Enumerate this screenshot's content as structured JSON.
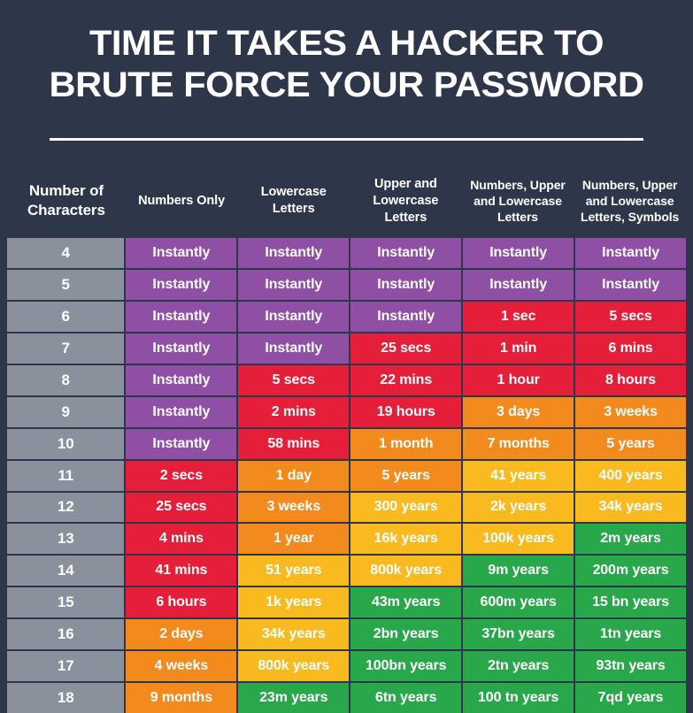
{
  "title": {
    "line1": "TIME IT TAKES A HACKER TO",
    "line2": "BRUTE FORCE YOUR PASSWORD"
  },
  "colors": {
    "background": "#2e3649",
    "label_column": "#8a909c",
    "purple": "#8e4fa5",
    "red": "#e51f39",
    "orange": "#f28a1e",
    "yellow": "#f8ba1f",
    "green": "#28a84a",
    "text": "#ffffff"
  },
  "table": {
    "headers": [
      "Number of Characters",
      "Numbers Only",
      "Lowercase Letters",
      "Upper and Lowercase Letters",
      "Numbers, Upper and Lowercase Letters",
      "Numbers, Upper and Lowercase Letters, Symbols"
    ],
    "rows": [
      {
        "chars": "4",
        "cells": [
          {
            "text": "Instantly",
            "sev": "purple"
          },
          {
            "text": "Instantly",
            "sev": "purple"
          },
          {
            "text": "Instantly",
            "sev": "purple"
          },
          {
            "text": "Instantly",
            "sev": "purple"
          },
          {
            "text": "Instantly",
            "sev": "purple"
          }
        ]
      },
      {
        "chars": "5",
        "cells": [
          {
            "text": "Instantly",
            "sev": "purple"
          },
          {
            "text": "Instantly",
            "sev": "purple"
          },
          {
            "text": "Instantly",
            "sev": "purple"
          },
          {
            "text": "Instantly",
            "sev": "purple"
          },
          {
            "text": "Instantly",
            "sev": "purple"
          }
        ]
      },
      {
        "chars": "6",
        "cells": [
          {
            "text": "Instantly",
            "sev": "purple"
          },
          {
            "text": "Instantly",
            "sev": "purple"
          },
          {
            "text": "Instantly",
            "sev": "purple"
          },
          {
            "text": "1 sec",
            "sev": "red"
          },
          {
            "text": "5 secs",
            "sev": "red"
          }
        ]
      },
      {
        "chars": "7",
        "cells": [
          {
            "text": "Instantly",
            "sev": "purple"
          },
          {
            "text": "Instantly",
            "sev": "purple"
          },
          {
            "text": "25 secs",
            "sev": "red"
          },
          {
            "text": "1 min",
            "sev": "red"
          },
          {
            "text": "6 mins",
            "sev": "red"
          }
        ]
      },
      {
        "chars": "8",
        "cells": [
          {
            "text": "Instantly",
            "sev": "purple"
          },
          {
            "text": "5 secs",
            "sev": "red"
          },
          {
            "text": "22 mins",
            "sev": "red"
          },
          {
            "text": "1 hour",
            "sev": "red"
          },
          {
            "text": "8 hours",
            "sev": "red"
          }
        ]
      },
      {
        "chars": "9",
        "cells": [
          {
            "text": "Instantly",
            "sev": "purple"
          },
          {
            "text": "2 mins",
            "sev": "red"
          },
          {
            "text": "19 hours",
            "sev": "red"
          },
          {
            "text": "3 days",
            "sev": "orange"
          },
          {
            "text": "3 weeks",
            "sev": "orange"
          }
        ]
      },
      {
        "chars": "10",
        "cells": [
          {
            "text": "Instantly",
            "sev": "purple"
          },
          {
            "text": "58 mins",
            "sev": "red"
          },
          {
            "text": "1 month",
            "sev": "orange"
          },
          {
            "text": "7 months",
            "sev": "orange"
          },
          {
            "text": "5 years",
            "sev": "orange"
          }
        ]
      },
      {
        "chars": "11",
        "cells": [
          {
            "text": "2 secs",
            "sev": "red"
          },
          {
            "text": "1 day",
            "sev": "orange"
          },
          {
            "text": "5 years",
            "sev": "orange"
          },
          {
            "text": "41 years",
            "sev": "yellow"
          },
          {
            "text": "400 years",
            "sev": "yellow"
          }
        ]
      },
      {
        "chars": "12",
        "cells": [
          {
            "text": "25 secs",
            "sev": "red"
          },
          {
            "text": "3 weeks",
            "sev": "orange"
          },
          {
            "text": "300 years",
            "sev": "yellow"
          },
          {
            "text": "2k years",
            "sev": "yellow"
          },
          {
            "text": "34k years",
            "sev": "yellow"
          }
        ]
      },
      {
        "chars": "13",
        "cells": [
          {
            "text": "4 mins",
            "sev": "red"
          },
          {
            "text": "1 year",
            "sev": "orange"
          },
          {
            "text": "16k years",
            "sev": "yellow"
          },
          {
            "text": "100k years",
            "sev": "yellow"
          },
          {
            "text": "2m years",
            "sev": "green"
          }
        ]
      },
      {
        "chars": "14",
        "cells": [
          {
            "text": "41 mins",
            "sev": "red"
          },
          {
            "text": "51 years",
            "sev": "yellow"
          },
          {
            "text": "800k years",
            "sev": "yellow"
          },
          {
            "text": "9m years",
            "sev": "green"
          },
          {
            "text": "200m years",
            "sev": "green"
          }
        ]
      },
      {
        "chars": "15",
        "cells": [
          {
            "text": "6 hours",
            "sev": "red"
          },
          {
            "text": "1k years",
            "sev": "yellow"
          },
          {
            "text": "43m years",
            "sev": "green"
          },
          {
            "text": "600m years",
            "sev": "green"
          },
          {
            "text": "15 bn years",
            "sev": "green"
          }
        ]
      },
      {
        "chars": "16",
        "cells": [
          {
            "text": "2 days",
            "sev": "orange"
          },
          {
            "text": "34k years",
            "sev": "yellow"
          },
          {
            "text": "2bn years",
            "sev": "green"
          },
          {
            "text": "37bn years",
            "sev": "green"
          },
          {
            "text": "1tn years",
            "sev": "green"
          }
        ]
      },
      {
        "chars": "17",
        "cells": [
          {
            "text": "4 weeks",
            "sev": "orange"
          },
          {
            "text": "800k years",
            "sev": "yellow"
          },
          {
            "text": "100bn years",
            "sev": "green"
          },
          {
            "text": "2tn years",
            "sev": "green"
          },
          {
            "text": "93tn years",
            "sev": "green"
          }
        ]
      },
      {
        "chars": "18",
        "cells": [
          {
            "text": "9 months",
            "sev": "orange"
          },
          {
            "text": "23m years",
            "sev": "green"
          },
          {
            "text": "6tn years",
            "sev": "green"
          },
          {
            "text": "100 tn years",
            "sev": "green"
          },
          {
            "text": "7qd years",
            "sev": "green"
          }
        ]
      }
    ]
  }
}
